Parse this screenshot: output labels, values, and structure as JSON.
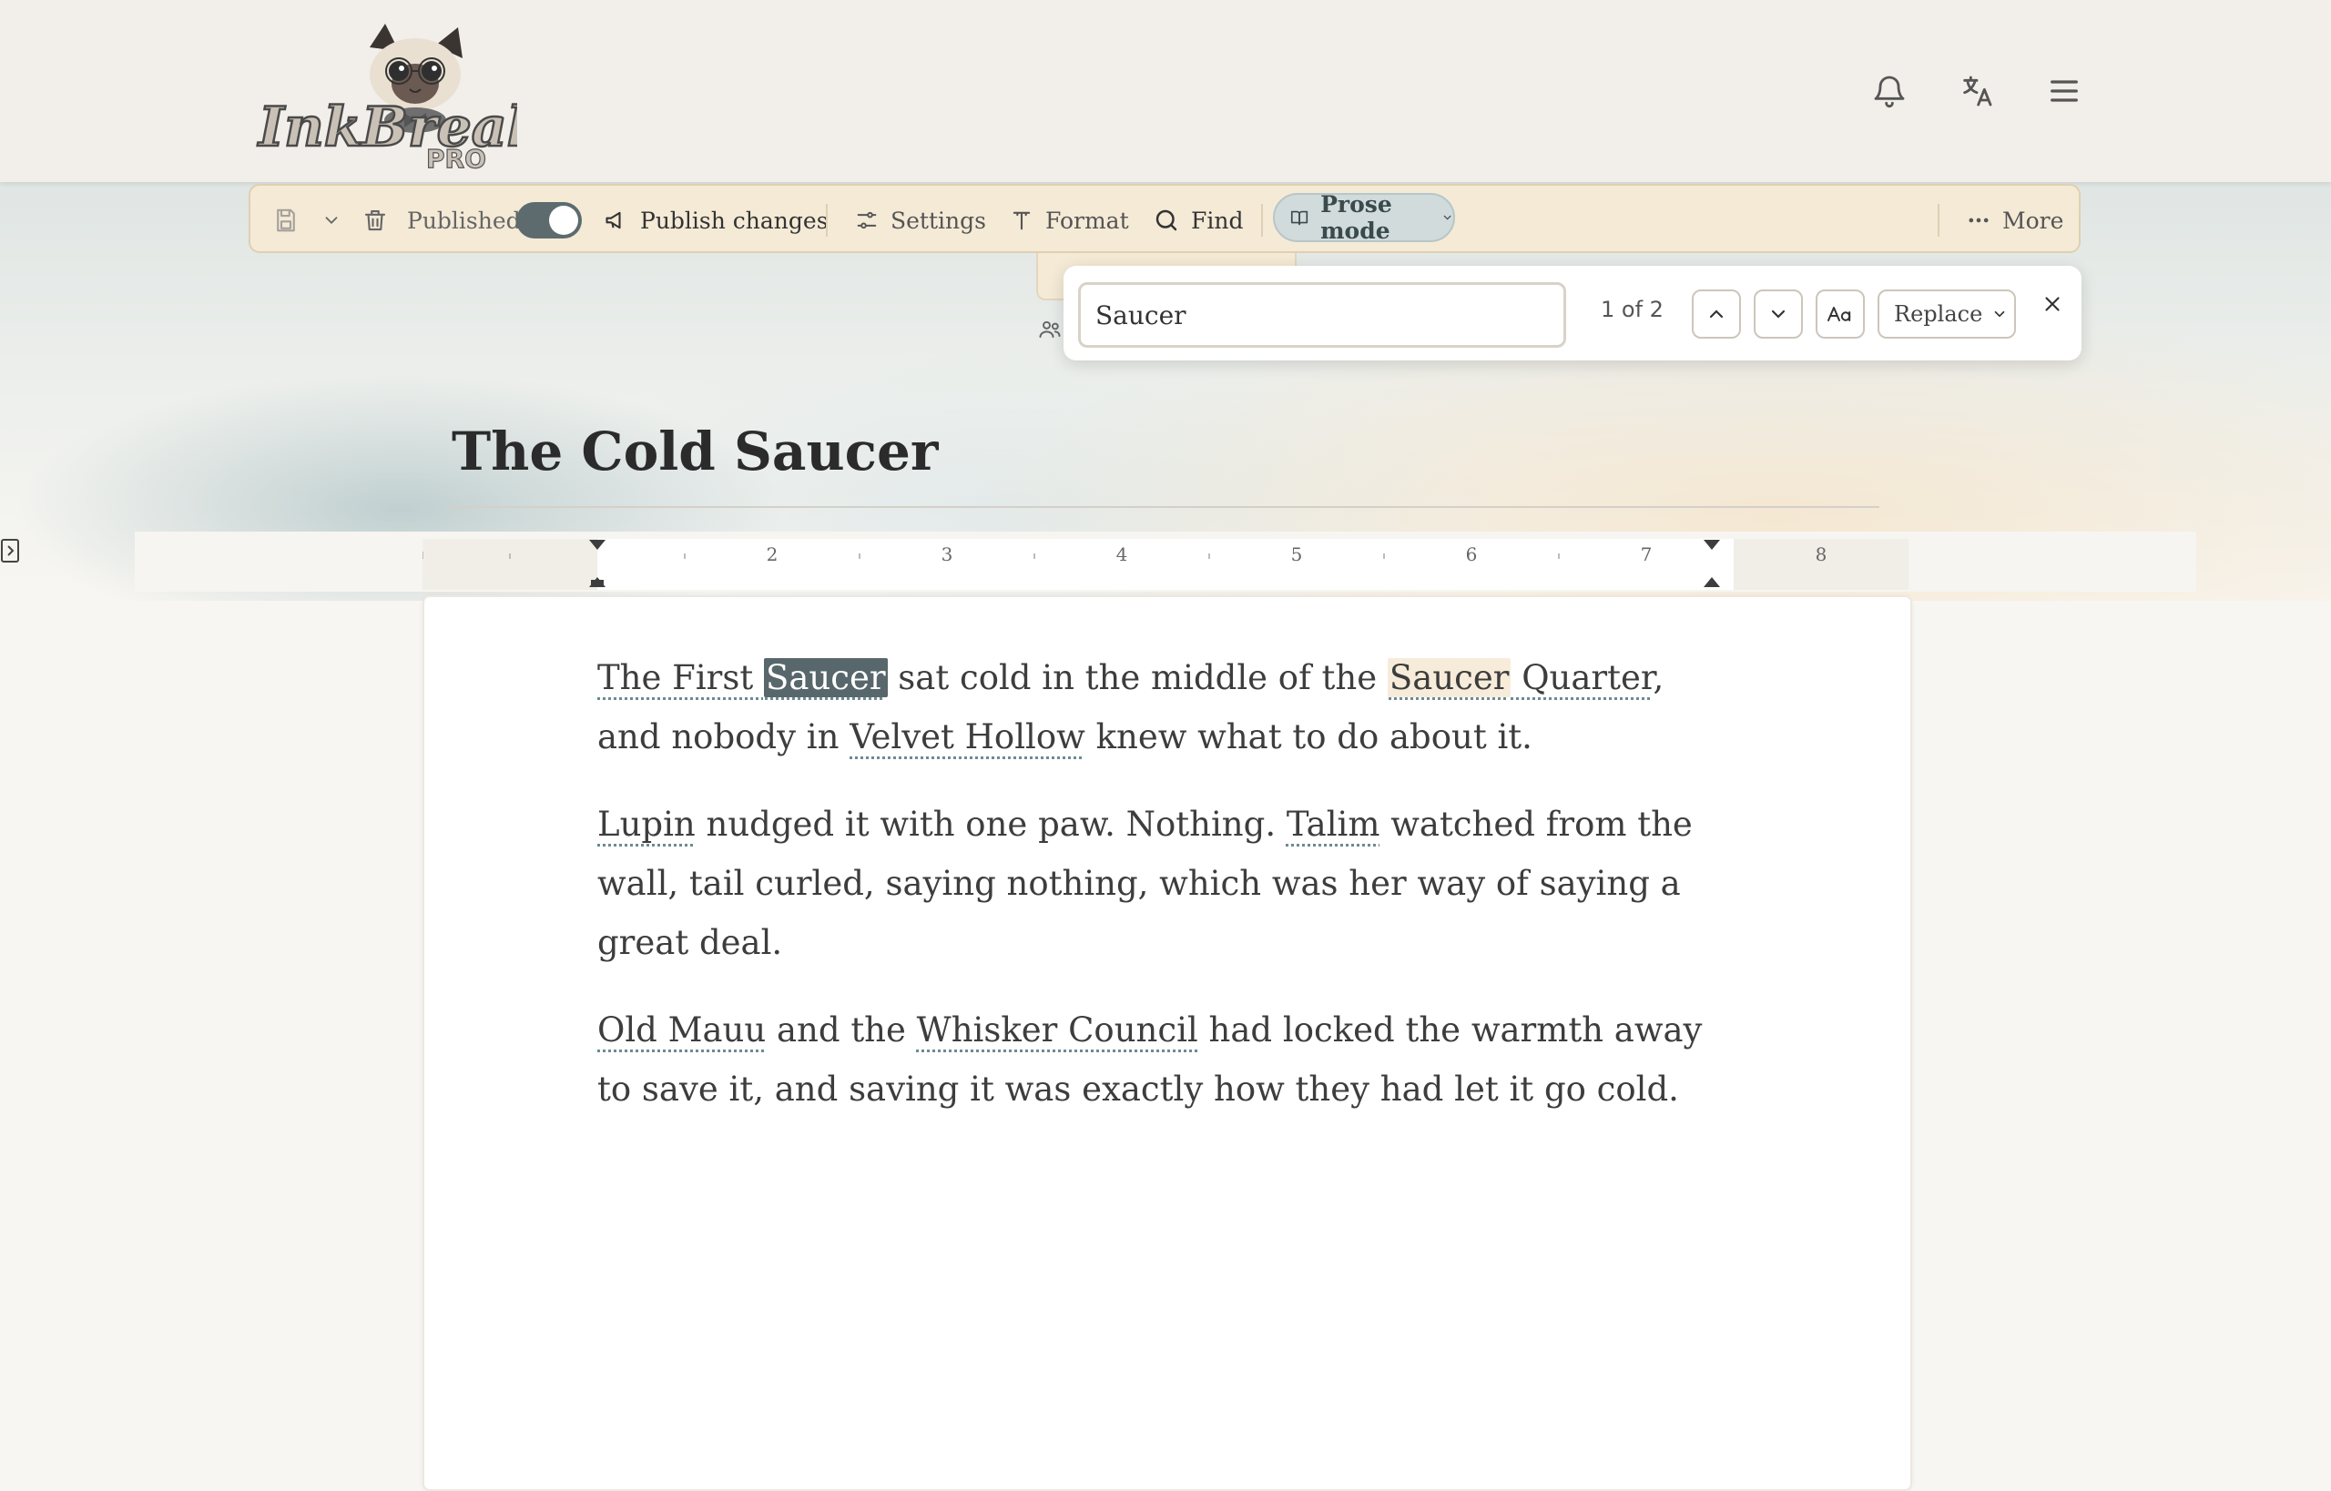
{
  "app": {
    "name": "InkBreaker",
    "tier": "PRO"
  },
  "toolbar": {
    "status_label": "Published",
    "publish_label": "Publish changes",
    "settings_label": "Settings",
    "format_label": "Format",
    "find_label": "Find",
    "mode_label": "Prose mode",
    "more_label": "More",
    "published_on": true
  },
  "find": {
    "query": "Saucer",
    "count": "1 of 2",
    "replace_label": "Replace"
  },
  "document": {
    "title": "The Cold Saucer",
    "p1": {
      "e1": "The First ",
      "e1_match": "Saucer",
      "t1": " sat cold in the middle of the ",
      "e2_match": "Saucer",
      "e2_rest": " Quarter",
      "t2": ", and nobody in ",
      "e3": "Velvet Hollow",
      "t3": " knew what to do about it."
    },
    "p2": {
      "e1": "Lupin",
      "t1": " nudged it with one paw. Nothing. ",
      "e2": "Talim",
      "t2": " watched from the wall, tail curled, saying nothing, which was her way of saying a great deal."
    },
    "p3": {
      "e1": "Old Mauu",
      "t1": " and the ",
      "e2": "Whisker Council",
      "t2": " had locked the warmth away to save it, and saving it was exactly how they had let it go cold."
    }
  },
  "ruler": {
    "labels": [
      "2",
      "3",
      "4",
      "5",
      "6",
      "7",
      "8"
    ]
  },
  "colors": {
    "accent": "#58676b",
    "toolbar_bg": "#f4ead6",
    "header_bg": "#f2efea",
    "match_bg": "#f7ecda"
  }
}
